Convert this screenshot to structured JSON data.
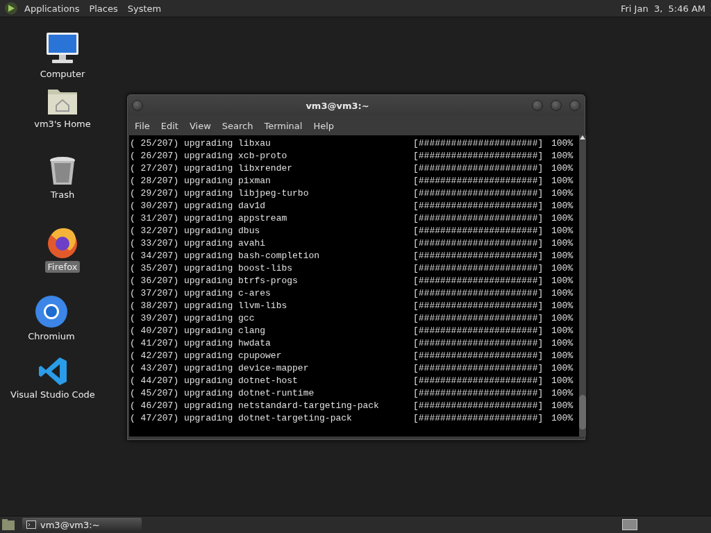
{
  "top_panel": {
    "menus": [
      "Applications",
      "Places",
      "System"
    ],
    "clock": "Fri Jan  3,  5:46 AM"
  },
  "desktop_icons": [
    {
      "kind": "computer",
      "label": "Computer",
      "selected": false
    },
    {
      "kind": "home",
      "label": "vm3's Home",
      "selected": false
    },
    {
      "kind": "trash",
      "label": "Trash",
      "selected": false
    },
    {
      "kind": "firefox",
      "label": "Firefox",
      "selected": true
    },
    {
      "kind": "chromium",
      "label": "Chromium",
      "selected": false
    },
    {
      "kind": "vscode",
      "label": "Visual Studio Code",
      "selected": false
    }
  ],
  "terminal": {
    "title": "vm3@vm3:~",
    "menu": [
      "File",
      "Edit",
      "View",
      "Search",
      "Terminal",
      "Help"
    ],
    "lines": [
      {
        "text": "( 25/207) upgrading libxau",
        "bar": "[######################]",
        "percent": "100%"
      },
      {
        "text": "( 26/207) upgrading xcb-proto",
        "bar": "[######################]",
        "percent": "100%"
      },
      {
        "text": "( 27/207) upgrading libxrender",
        "bar": "[######################]",
        "percent": "100%"
      },
      {
        "text": "( 28/207) upgrading pixman",
        "bar": "[######################]",
        "percent": "100%"
      },
      {
        "text": "( 29/207) upgrading libjpeg-turbo",
        "bar": "[######################]",
        "percent": "100%"
      },
      {
        "text": "( 30/207) upgrading dav1d",
        "bar": "[######################]",
        "percent": "100%"
      },
      {
        "text": "( 31/207) upgrading appstream",
        "bar": "[######################]",
        "percent": "100%"
      },
      {
        "text": "( 32/207) upgrading dbus",
        "bar": "[######################]",
        "percent": "100%"
      },
      {
        "text": "( 33/207) upgrading avahi",
        "bar": "[######################]",
        "percent": "100%"
      },
      {
        "text": "( 34/207) upgrading bash-completion",
        "bar": "[######################]",
        "percent": "100%"
      },
      {
        "text": "( 35/207) upgrading boost-libs",
        "bar": "[######################]",
        "percent": "100%"
      },
      {
        "text": "( 36/207) upgrading btrfs-progs",
        "bar": "[######################]",
        "percent": "100%"
      },
      {
        "text": "( 37/207) upgrading c-ares",
        "bar": "[######################]",
        "percent": "100%"
      },
      {
        "text": "( 38/207) upgrading llvm-libs",
        "bar": "[######################]",
        "percent": "100%"
      },
      {
        "text": "( 39/207) upgrading gcc",
        "bar": "[######################]",
        "percent": "100%"
      },
      {
        "text": "( 40/207) upgrading clang",
        "bar": "[######################]",
        "percent": "100%"
      },
      {
        "text": "( 41/207) upgrading hwdata",
        "bar": "[######################]",
        "percent": "100%"
      },
      {
        "text": "( 42/207) upgrading cpupower",
        "bar": "[######################]",
        "percent": "100%"
      },
      {
        "text": "( 43/207) upgrading device-mapper",
        "bar": "[######################]",
        "percent": "100%"
      },
      {
        "text": "( 44/207) upgrading dotnet-host",
        "bar": "[######################]",
        "percent": "100%"
      },
      {
        "text": "( 45/207) upgrading dotnet-runtime",
        "bar": "[######################]",
        "percent": "100%"
      },
      {
        "text": "( 46/207) upgrading netstandard-targeting-pack",
        "bar": "[######################]",
        "percent": "100%"
      },
      {
        "text": "( 47/207) upgrading dotnet-targeting-pack",
        "bar": "[######################]",
        "percent": "100%"
      }
    ]
  },
  "taskbar": {
    "tasks": [
      {
        "label": "vm3@vm3:~",
        "selected": false
      }
    ]
  }
}
